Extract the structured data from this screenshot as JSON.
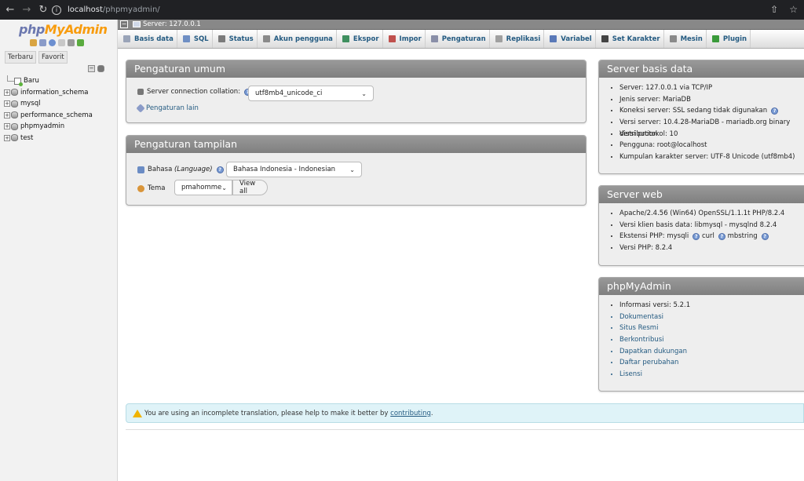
{
  "browser": {
    "url_host": "localhost",
    "url_path": "/phpmyadmin/"
  },
  "left_panel": {
    "logo_php": "php",
    "logo_my": "MyAdmin",
    "tabs": [
      "Terbaru",
      "Favorit"
    ],
    "databases": [
      {
        "name": "Baru",
        "type": "new"
      },
      {
        "name": "information_schema",
        "type": "db"
      },
      {
        "name": "mysql",
        "type": "db"
      },
      {
        "name": "performance_schema",
        "type": "db"
      },
      {
        "name": "phpmyadmin",
        "type": "db"
      },
      {
        "name": "test",
        "type": "db"
      }
    ]
  },
  "server_bar": {
    "label": "Server: 127.0.0.1"
  },
  "menu": [
    {
      "label": "Basis data",
      "icon": "database-icon",
      "color": "#9aa4b8"
    },
    {
      "label": "SQL",
      "icon": "sql-icon",
      "color": "#6f8fc4"
    },
    {
      "label": "Status",
      "icon": "status-icon",
      "color": "#7b7b7b"
    },
    {
      "label": "Akun pengguna",
      "icon": "users-icon",
      "color": "#8a8a8a"
    },
    {
      "label": "Ekspor",
      "icon": "export-icon",
      "color": "#3f8f5f"
    },
    {
      "label": "Impor",
      "icon": "import-icon",
      "color": "#c0504d"
    },
    {
      "label": "Pengaturan",
      "icon": "wrench-icon",
      "color": "#8a8fa8"
    },
    {
      "label": "Replikasi",
      "icon": "replication-icon",
      "color": "#a0a0a0"
    },
    {
      "label": "Variabel",
      "icon": "variables-icon",
      "color": "#5a79b8"
    },
    {
      "label": "Set Karakter",
      "icon": "charset-icon",
      "color": "#444444"
    },
    {
      "label": "Mesin",
      "icon": "engine-icon",
      "color": "#8a8a8a"
    },
    {
      "label": "Plugin",
      "icon": "plugin-icon",
      "color": "#3a9a3a"
    }
  ],
  "general_settings": {
    "title": "Pengaturan umum",
    "collation_label": "Server connection collation:",
    "collation_value": "utf8mb4_unicode_ci",
    "more_settings": "Pengaturan lain"
  },
  "appearance_settings": {
    "title": "Pengaturan tampilan",
    "language_label": "Bahasa",
    "language_label_italic": "(Language)",
    "language_value": "Bahasa Indonesia - Indonesian",
    "theme_label": "Tema",
    "theme_value": "pmahomme",
    "view_all": "View all"
  },
  "db_server": {
    "title": "Server basis data",
    "items": [
      "Server: 127.0.0.1 via TCP/IP",
      "Jenis server: MariaDB",
      "Koneksi server: SSL sedang tidak digunakan",
      "Versi server: 10.4.28-MariaDB - mariadb.org binary distribution",
      "Versi protokol: 10",
      "Pengguna: root@localhost",
      "Kumpulan karakter server: UTF-8 Unicode (utf8mb4)"
    ]
  },
  "web_server": {
    "title": "Server web",
    "items": [
      "Apache/2.4.56 (Win64) OpenSSL/1.1.1t PHP/8.2.4",
      "Versi klien basis data: libmysql - mysqlnd 8.2.4",
      "Ekstensi PHP: mysqli",
      "curl",
      "mbstring",
      "Versi PHP: 8.2.4"
    ]
  },
  "pma": {
    "title": "phpMyAdmin",
    "version": "Informasi versi: 5.2.1",
    "links": [
      "Dokumentasi",
      "Situs Resmi",
      "Berkontribusi",
      "Dapatkan dukungan",
      "Daftar perubahan",
      "Lisensi"
    ]
  },
  "notice": {
    "text": "You are using an incomplete translation, please help to make it better by",
    "link": "contributing",
    "end": "."
  }
}
